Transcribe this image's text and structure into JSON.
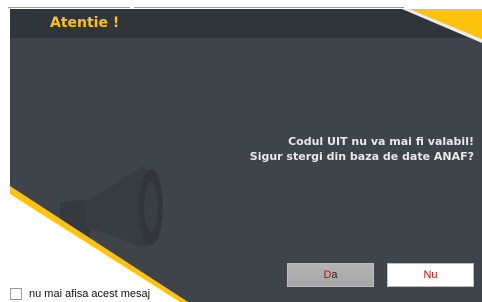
{
  "dialog": {
    "title": "Atentie !",
    "message_line1": "Codul UIT nu va mai fi valabil!",
    "message_line2": "Sigur stergi din baza de date ANAF?",
    "buttons": {
      "da_first": "D",
      "da_rest": "a",
      "nu": "Nu"
    },
    "checkbox_label": "nu mai afisa acest mesaj",
    "checkbox_checked": false,
    "icon": "megaphone-icon"
  },
  "colors": {
    "accent_yellow": "#ffc20e",
    "dialog_bg": "#3f444b",
    "header_bg": "#30353b",
    "button_red_text": "#e00000"
  }
}
